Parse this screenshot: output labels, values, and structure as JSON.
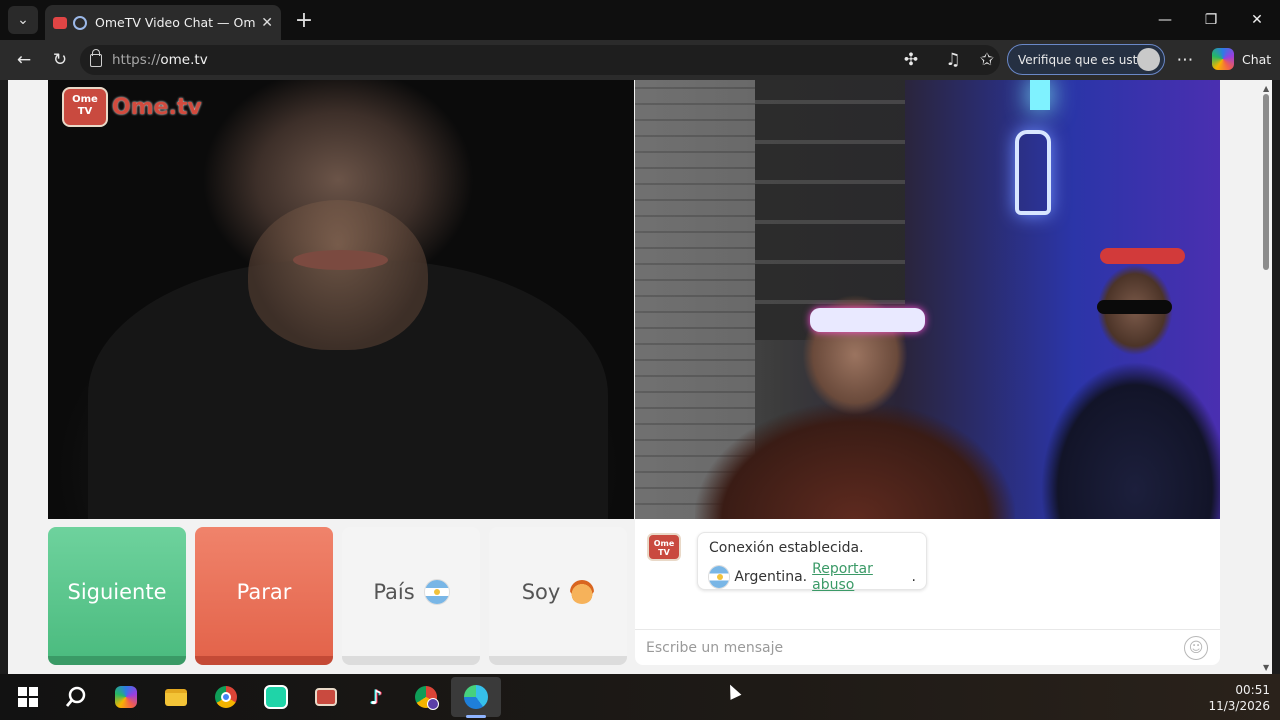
{
  "browser": {
    "tab": {
      "title": "OmeTV Video Chat — Omegle"
    },
    "url": {
      "prefix": "https://",
      "host": "ome.tv"
    },
    "verify_label": "Verifique que es usted",
    "chat_label": "Chat"
  },
  "site": {
    "logo_badge": "Ome TV",
    "logo_text": "Ome.tv"
  },
  "controls": {
    "next_label": "Siguiente",
    "stop_label": "Parar",
    "country_label": "País",
    "gender_label": "Soy"
  },
  "chat": {
    "logo_badge": "Ome TV",
    "system_message": "Conexión establecida.",
    "country": "Argentina.",
    "report_link": "Reportar abuso",
    "report_suffix": ".",
    "input_placeholder": "Escribe un mensaje"
  },
  "taskbar": {
    "time": "00:51",
    "date": "11/3/2026"
  },
  "colors": {
    "next": "#4cbc80",
    "stop": "#e3644b",
    "link": "#3b9a67",
    "brand": "#d24b3e"
  }
}
